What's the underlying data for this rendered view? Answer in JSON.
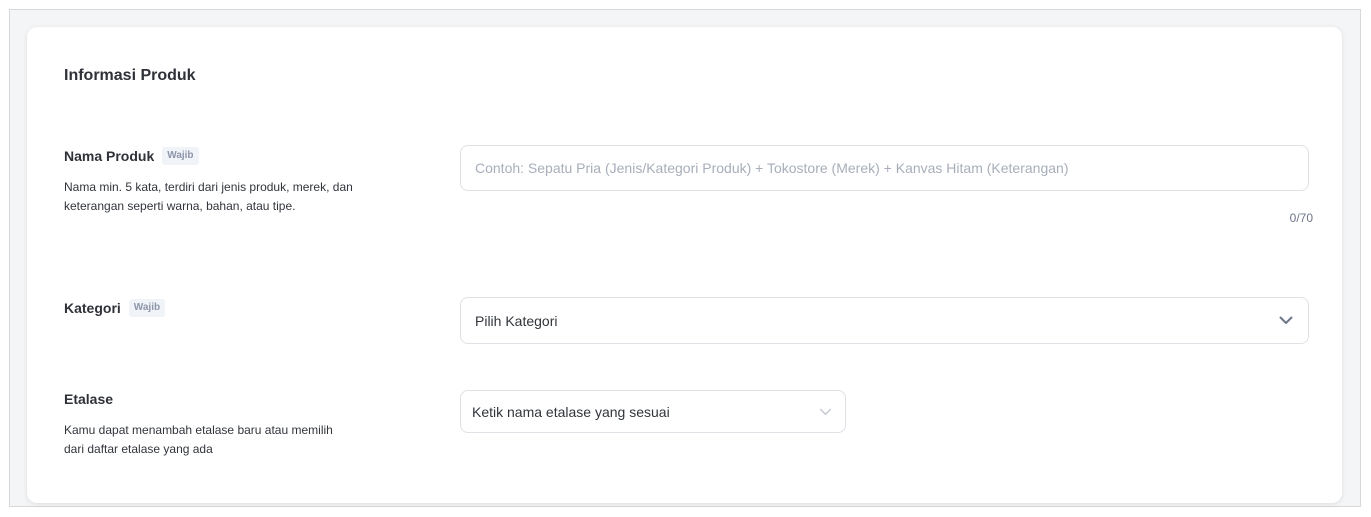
{
  "section": {
    "title": "Informasi Produk"
  },
  "nama_produk": {
    "label": "Nama Produk",
    "badge": "Wajib",
    "description": "Nama min. 5 kata, terdiri dari jenis produk, merek, dan keterangan seperti warna, bahan, atau tipe.",
    "placeholder": "Contoh: Sepatu Pria (Jenis/Kategori Produk) + Tokostore (Merek) + Kanvas Hitam (Keterangan)",
    "value": "",
    "counter": "0/70"
  },
  "kategori": {
    "label": "Kategori",
    "badge": "Wajib",
    "selected": "Pilih Kategori",
    "icon": "chevron-down-icon"
  },
  "etalase": {
    "label": "Etalase",
    "description": "Kamu dapat menambah etalase baru atau memilih dari daftar etalase yang ada",
    "selected": "Ketik nama etalase yang sesuai",
    "icon": "chevron-down-icon"
  },
  "colors": {
    "text_primary": "#2e3137",
    "placeholder": "#a8aeb9",
    "border": "#dfe1e6",
    "badge_bg": "#f0f3f7"
  }
}
